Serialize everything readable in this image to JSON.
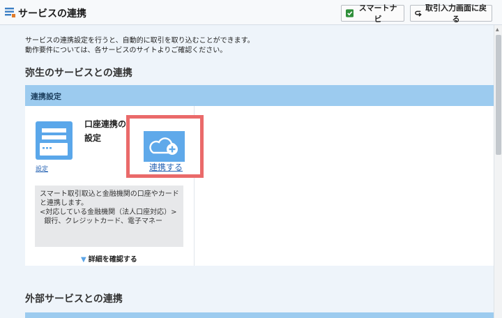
{
  "window": {
    "title": "サービスの連携"
  },
  "toolbar": {
    "smart_navi_label": "スマートナビ",
    "back_label": "取引入力画面に戻る"
  },
  "intro": {
    "line1": "サービスの連携設定を行うと、自動的に取引を取り込むことができます。",
    "line2": "動作要件については、各サービスのサイトよりご確認ください。"
  },
  "sections": {
    "yayoi_title": "弥生のサービスとの連携",
    "external_title": "外部サービスとの連携"
  },
  "panel": {
    "header_label": "連携設定",
    "card": {
      "settings_link": "設定",
      "title": "口座連携の設定",
      "connect_label": "連携する",
      "description": [
        "スマート取引取込と金融機関の口座やカード",
        "と連携します。",
        "<対応している金融機関（法人口座対応）>",
        "  銀行、クレジットカード、電子マネー"
      ],
      "detail_label": "詳細を確認する"
    }
  },
  "icons": {
    "app": "app-list-icon",
    "smart_navi": "checkmark-icon",
    "back": "return-arrow-icon",
    "card": "bank-card-icon",
    "connect": "cloud-plus-icon",
    "detail": "triangle-down-icon"
  },
  "colors": {
    "panel_header": "#9ccbef",
    "content_bg": "#eef4fa",
    "highlight": "#ea6a6a",
    "accent_blue": "#5fa9ea",
    "link": "#2a66b5"
  }
}
